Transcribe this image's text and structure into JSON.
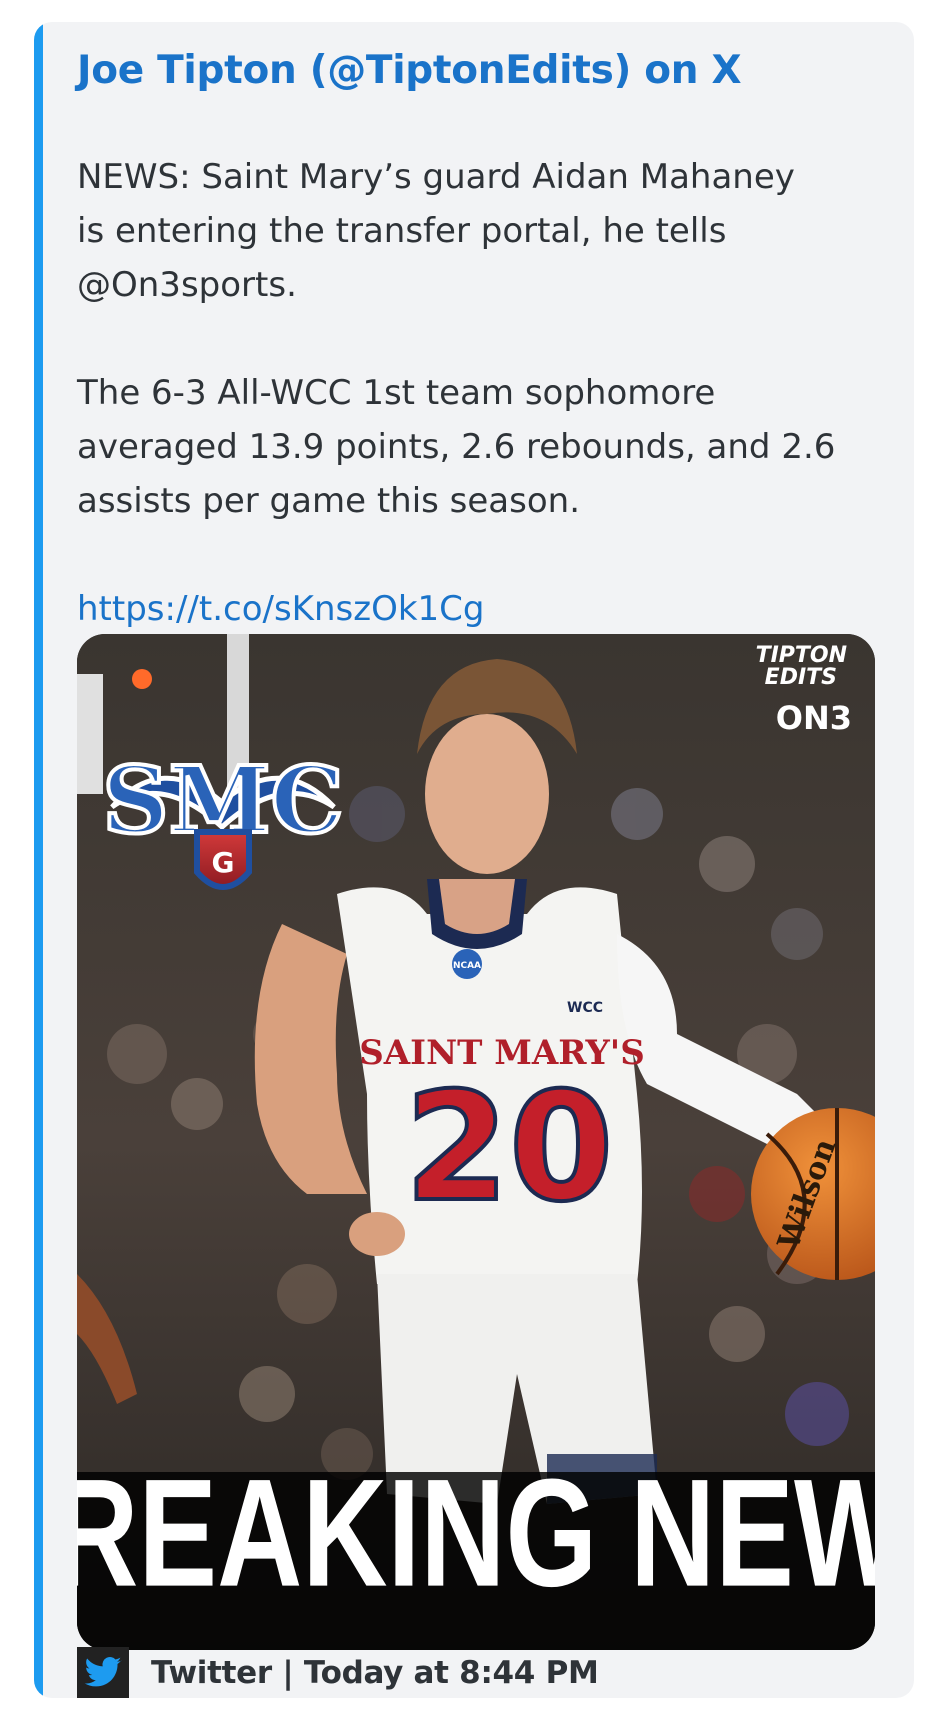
{
  "embed": {
    "accent_color": "#1d9bf0",
    "author": "Joe Tipton (@TiptonEdits) on X",
    "body_lines": [
      "NEWS: Saint Mary’s guard Aidan Mahaney",
      "is entering the transfer portal, he tells",
      "@On3sports.",
      "The 6-3 All-WCC 1st team sophomore",
      "averaged 13.9 points, 2.6 rebounds, and 2.6",
      "assists per game this season."
    ],
    "link": "https://t.co/sKnszOk1Cg",
    "image": {
      "brand_top": "TIPTON",
      "brand_mid": "EDITS",
      "brand_on3": "ON3",
      "logo_letters": "SMC",
      "logo_shield_letter": "G",
      "ncaa_badge": "NCAA",
      "jersey_conference": "WCC",
      "jersey_team": "SAINT MARY'S",
      "jersey_number": "20",
      "ball_brand": "Wilson",
      "banner": "BREAKING NEWS"
    },
    "footer": {
      "icon": "twitter-bird-icon",
      "text": "Twitter | Today at 8:44 PM"
    }
  }
}
